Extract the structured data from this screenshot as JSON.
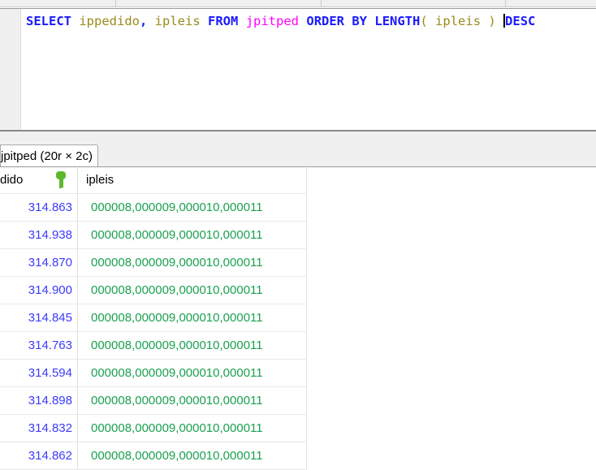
{
  "editor": {
    "sql": [
      {
        "t": "SELECT",
        "c": "kw"
      },
      {
        "t": " "
      },
      {
        "t": "ippedido",
        "c": "id"
      },
      {
        "t": ", ",
        "c": "kw"
      },
      {
        "t": "ipleis",
        "c": "id"
      },
      {
        "t": " "
      },
      {
        "t": "FROM",
        "c": "kw"
      },
      {
        "t": " "
      },
      {
        "t": "jpitped",
        "c": "tb"
      },
      {
        "t": " "
      },
      {
        "t": "ORDER BY",
        "c": "kw"
      },
      {
        "t": " "
      },
      {
        "t": "LENGTH",
        "c": "kw"
      },
      {
        "t": "( ",
        "c": "pn"
      },
      {
        "t": "ipleis",
        "c": "id"
      },
      {
        "t": " ) ",
        "c": "pn"
      },
      {
        "t": "|caret"
      },
      {
        "t": "DESC",
        "c": "kw"
      }
    ]
  },
  "result_tab": {
    "label": "jpitped (20r × 2c)"
  },
  "grid": {
    "columns": [
      "dido",
      "ipleis"
    ],
    "rows": [
      [
        "314.863",
        "000008,000009,000010,000011"
      ],
      [
        "314.938",
        "000008,000009,000010,000011"
      ],
      [
        "314.870",
        "000008,000009,000010,000011"
      ],
      [
        "314.900",
        "000008,000009,000010,000011"
      ],
      [
        "314.845",
        "000008,000009,000010,000011"
      ],
      [
        "314.763",
        "000008,000009,000010,000011"
      ],
      [
        "314.594",
        "000008,000009,000010,000011"
      ],
      [
        "314.898",
        "000008,000009,000010,000011"
      ],
      [
        "314.832",
        "000008,000009,000010,000011"
      ],
      [
        "314.862",
        "000008,000009,000010,000011"
      ]
    ]
  }
}
